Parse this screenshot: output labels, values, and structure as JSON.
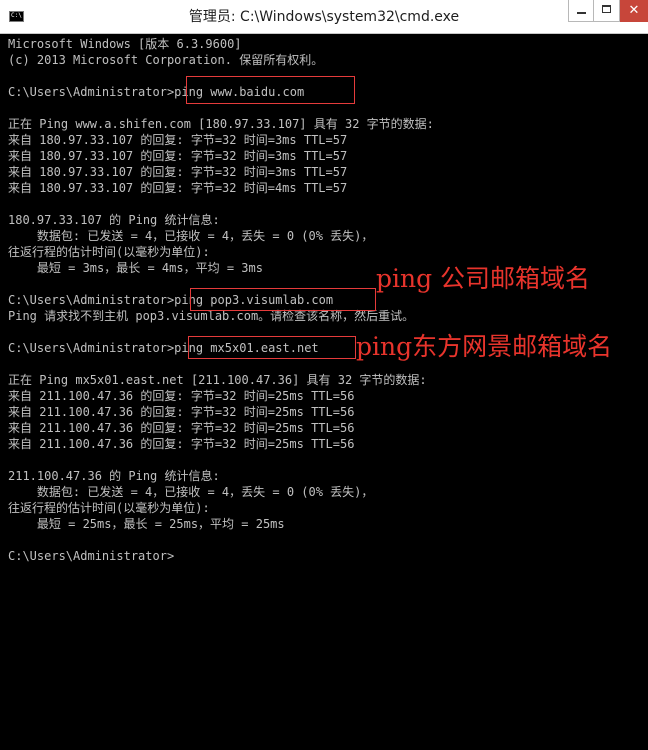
{
  "window": {
    "title": "管理员: C:\\Windows\\system32\\cmd.exe",
    "icon_text": "C:\\",
    "buttons": {
      "minimize": "minimize-icon",
      "maximize": "maximize-icon",
      "close_label": "✕"
    },
    "close_color": "#c7463a"
  },
  "console": {
    "text_color": "#c0c0c0",
    "lines": [
      "Microsoft Windows [版本 6.3.9600]",
      "(c) 2013 Microsoft Corporation. 保留所有权利。",
      "",
      "C:\\Users\\Administrator>ping www.baidu.com",
      "",
      "正在 Ping www.a.shifen.com [180.97.33.107] 具有 32 字节的数据:",
      "来自 180.97.33.107 的回复: 字节=32 时间=3ms TTL=57",
      "来自 180.97.33.107 的回复: 字节=32 时间=3ms TTL=57",
      "来自 180.97.33.107 的回复: 字节=32 时间=3ms TTL=57",
      "来自 180.97.33.107 的回复: 字节=32 时间=4ms TTL=57",
      "",
      "180.97.33.107 的 Ping 统计信息:",
      "    数据包: 已发送 = 4，已接收 = 4，丢失 = 0 (0% 丢失)，",
      "往返行程的估计时间(以毫秒为单位):",
      "    最短 = 3ms，最长 = 4ms，平均 = 3ms",
      "",
      "C:\\Users\\Administrator>ping pop3.visumlab.com",
      "Ping 请求找不到主机 pop3.visumlab.com。请检查该名称，然后重试。",
      "",
      "C:\\Users\\Administrator>ping mx5x01.east.net",
      "",
      "正在 Ping mx5x01.east.net [211.100.47.36] 具有 32 字节的数据:",
      "来自 211.100.47.36 的回复: 字节=32 时间=25ms TTL=56",
      "来自 211.100.47.36 的回复: 字节=32 时间=25ms TTL=56",
      "来自 211.100.47.36 的回复: 字节=32 时间=25ms TTL=56",
      "来自 211.100.47.36 的回复: 字节=32 时间=25ms TTL=56",
      "",
      "211.100.47.36 的 Ping 统计信息:",
      "    数据包: 已发送 = 4，已接收 = 4，丢失 = 0 (0% 丢失)，",
      "往返行程的估计时间(以毫秒为单位):",
      "    最短 = 25ms，最长 = 25ms，平均 = 25ms",
      "",
      "C:\\Users\\Administrator>"
    ]
  },
  "annotations": {
    "color": "#e8342c",
    "label_1": "ping  公司邮箱域名",
    "label_2": "ping东方网景邮箱域名"
  }
}
